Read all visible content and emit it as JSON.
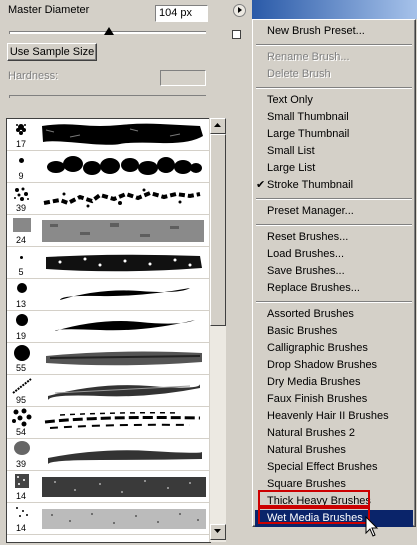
{
  "brush_panel": {
    "master_diameter_label": "Master Diameter",
    "diameter_value": "104 px",
    "use_sample_size_label": "Use Sample Size",
    "hardness_label": "Hardness:",
    "hardness_value": ""
  },
  "brushes": [
    {
      "size": "17"
    },
    {
      "size": "9"
    },
    {
      "size": "39"
    },
    {
      "size": "24"
    },
    {
      "size": "5"
    },
    {
      "size": "13"
    },
    {
      "size": "19"
    },
    {
      "size": "55"
    },
    {
      "size": "95"
    },
    {
      "size": "54"
    },
    {
      "size": "39"
    },
    {
      "size": "14"
    },
    {
      "size": "14"
    }
  ],
  "menu": {
    "new_brush_preset": "New Brush Preset...",
    "rename_brush": "Rename Brush...",
    "delete_brush": "Delete Brush",
    "text_only": "Text Only",
    "small_thumbnail": "Small Thumbnail",
    "large_thumbnail": "Large Thumbnail",
    "small_list": "Small List",
    "large_list": "Large List",
    "stroke_thumbnail": "Stroke Thumbnail",
    "check_mark": "✔",
    "preset_manager": "Preset Manager...",
    "reset_brushes": "Reset Brushes...",
    "load_brushes": "Load Brushes...",
    "save_brushes": "Save Brushes...",
    "replace_brushes": "Replace Brushes...",
    "libraries": [
      "Assorted Brushes",
      "Basic Brushes",
      "Calligraphic Brushes",
      "Drop Shadow Brushes",
      "Dry Media Brushes",
      "Faux Finish Brushes",
      "Heavenly Hair II Brushes",
      "Natural Brushes 2",
      "Natural Brushes",
      "Special Effect Brushes",
      "Square Brushes",
      "Thick Heavy Brushes",
      "Wet Media Brushes"
    ]
  },
  "colors": {
    "selection": "#0a246a",
    "highlight_box": "#cc0000",
    "title_blue": "#2a5aa8"
  }
}
